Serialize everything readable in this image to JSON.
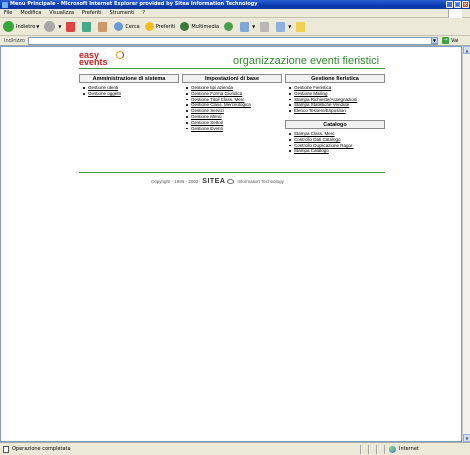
{
  "window": {
    "title": "Menu Principale - Microsoft Internet Explorer provided by Sitea Information Technology",
    "controls": [
      "_",
      "□",
      "×"
    ]
  },
  "menubar": [
    "File",
    "Modifica",
    "Visualizza",
    "Preferiti",
    "Strumenti",
    "?"
  ],
  "toolbar": {
    "back": "Indietro",
    "search": "Cerca",
    "favorites": "Preferiti",
    "multimedia": "Multimedia"
  },
  "address": {
    "label": "Indirizzo",
    "value": "",
    "go": "Vai"
  },
  "page": {
    "logo_line1": "easy",
    "logo_line2": "events",
    "brand_title": "organizzazione eventi fieristici",
    "sections": {
      "admin": {
        "title": "Amministrazione di sistema",
        "links": [
          "Gestione utenti",
          "Gestione oggetti"
        ]
      },
      "settings": {
        "title": "Impostazioni di base",
        "links": [
          "Gestione tipi azienda",
          "Gestione Forma Giuridica",
          "Gestione Titoli Class. Merc",
          "Gestione Class. Merceologica",
          "Gestione Servizi",
          "Gestione Menù",
          "Gestione Settori",
          "Gestione Eventi"
        ]
      },
      "fair": {
        "title": "Gestione fieristica",
        "links": [
          "Gestione Fieristica",
          "Gestione Mailing",
          "Stampa Richieste/Assegnazioni",
          "Stampa Statistiche Vendute",
          "Elenco Tessere/Espositori"
        ]
      },
      "catalog": {
        "title": "Catalogo",
        "links": [
          "Stampa Class. Merc",
          "Controllo Dati Catalogo",
          "Controllo Duplicazione Ragor.",
          "Stampa Catalogo"
        ]
      }
    },
    "footer": {
      "copyright": "Copyright - 1996 - 2002",
      "company": "SITEA",
      "tagline": "Information Technology"
    }
  },
  "statusbar": {
    "message": "Operazione completata",
    "zone": "Internet"
  }
}
